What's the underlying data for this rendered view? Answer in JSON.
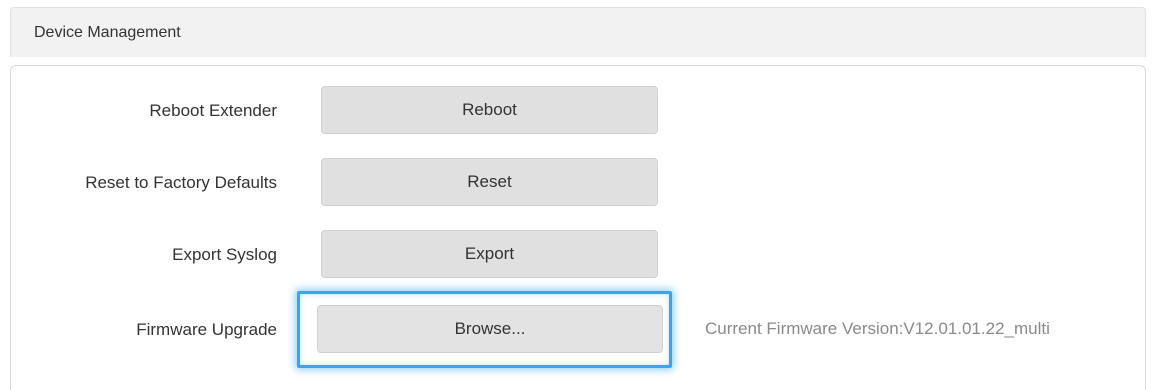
{
  "panel": {
    "title": "Device Management"
  },
  "rows": {
    "reboot": {
      "label": "Reboot Extender",
      "button": "Reboot"
    },
    "reset": {
      "label": "Reset to Factory Defaults",
      "button": "Reset"
    },
    "export": {
      "label": "Export Syslog",
      "button": "Export"
    },
    "firmware": {
      "label": "Firmware Upgrade",
      "button": "Browse...",
      "current_version": "Current Firmware Version:V12.01.01.22_multi"
    }
  },
  "colors": {
    "focus_ring": "#35a7f0",
    "button_bg": "#e0e0e0",
    "header_bg": "#f2f2f2",
    "secondary_text": "#8a8a8a"
  }
}
